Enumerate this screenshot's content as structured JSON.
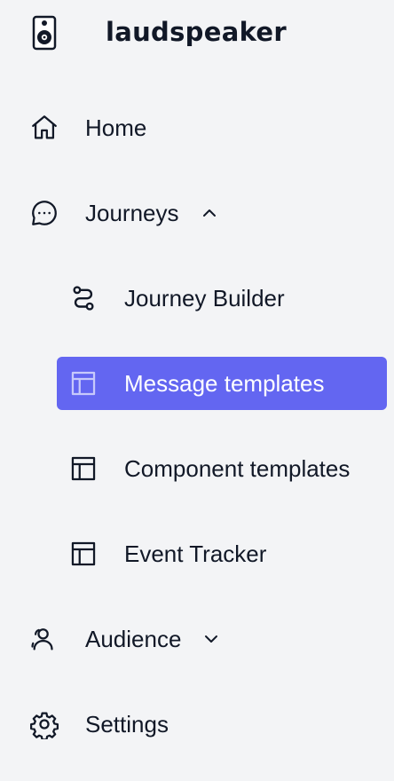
{
  "brand": {
    "name": "laudspeaker",
    "logo_icon": "speaker-icon"
  },
  "colors": {
    "background": "#f3f4f6",
    "text": "#111827",
    "active_bg": "#6366f1",
    "active_text": "#ffffff"
  },
  "nav": {
    "home": {
      "label": "Home",
      "icon": "home-icon"
    },
    "journeys": {
      "label": "Journeys",
      "icon": "chat-bubble-icon",
      "expanded": true
    },
    "journey_builder": {
      "label": "Journey Builder",
      "icon": "route-icon"
    },
    "message_templates": {
      "label": "Message templates",
      "icon": "template-icon",
      "active": true
    },
    "component_templates": {
      "label": "Component templates",
      "icon": "template-icon"
    },
    "event_tracker": {
      "label": "Event Tracker",
      "icon": "template-icon"
    },
    "audience": {
      "label": "Audience",
      "icon": "users-icon",
      "expanded": false
    },
    "settings": {
      "label": "Settings",
      "icon": "gear-icon"
    }
  }
}
